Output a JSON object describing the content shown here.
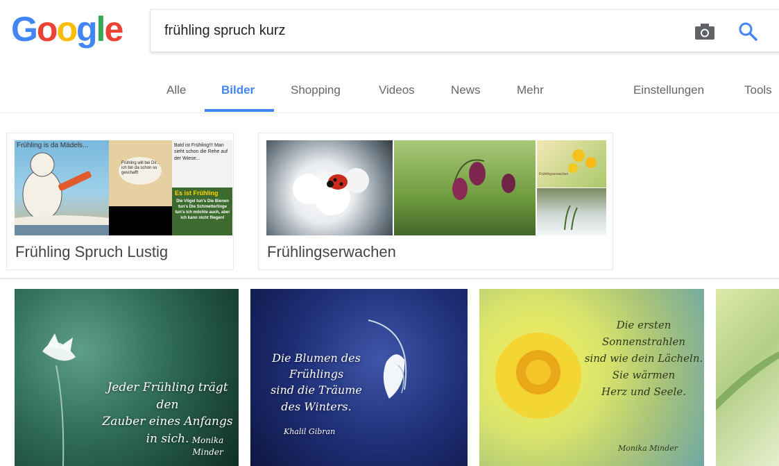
{
  "logo": [
    "G",
    "o",
    "o",
    "g",
    "l",
    "e"
  ],
  "logo_colors": [
    "#4285f4",
    "#ea4335",
    "#fbbc05",
    "#4285f4",
    "#34a853",
    "#ea4335"
  ],
  "search": {
    "query": "frühling spruch kurz"
  },
  "icons": {
    "camera": "camera-icon",
    "search": "search-icon"
  },
  "nav": {
    "tabs": [
      {
        "label": "Alle"
      },
      {
        "label": "Bilder"
      },
      {
        "label": "Shopping"
      },
      {
        "label": "Videos"
      },
      {
        "label": "News"
      },
      {
        "label": "Mehr"
      }
    ],
    "active": "Bilder",
    "settings": "Einstellungen",
    "tools": "Tools"
  },
  "clusters": [
    {
      "label": "Frühling Spruch Lustig",
      "thumbs": [
        {
          "caption": "Frühling is da Mädels..."
        },
        {
          "caption": "Frühling will bei Dir... ich bin da schon so geschafft"
        },
        {
          "caption": "Bald ist Frühling!!! Man sieht schon die Rehe auf der Wiese...",
          "caption2": "Es ist Frühling",
          "caption3": "Die Vögel tun's  Die Bienen tun's  Die Schmetterlinge tun's  Ich möchte auch, aber ich kann nicht fliegen!"
        }
      ]
    },
    {
      "label": "Frühlingserwachen",
      "thumbs": [
        {
          "caption": ""
        },
        {
          "caption": ""
        },
        {
          "caption": "Frühlingserwachen"
        }
      ]
    }
  ],
  "results": [
    {
      "lines": [
        "Jeder Frühling trägt den",
        "Zauber eines Anfangs in sich."
      ],
      "author": "Monika Minder"
    },
    {
      "lines": [
        "Die Blumen des Frühlings",
        "sind die Träume",
        "des Winters."
      ],
      "author": "Khalil Gibran"
    },
    {
      "lines": [
        "Die ersten",
        "Sonnenstrahlen",
        "sind wie dein Lächeln.",
        "Sie wärmen",
        "Herz und Seele."
      ],
      "author": "Monika Minder"
    }
  ],
  "colors": {
    "accent": "#4285f4",
    "text_gray": "#666666"
  }
}
